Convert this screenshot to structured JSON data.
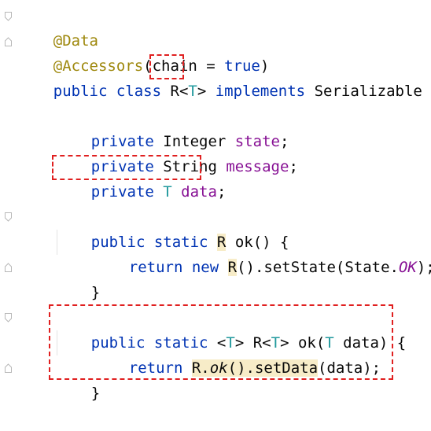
{
  "editor": {
    "lines": [
      {
        "id": "l1",
        "tokens": [
          "@Data"
        ]
      },
      {
        "id": "l2",
        "tokens": [
          "@Accessors",
          "(chain = ",
          "true",
          ")"
        ]
      },
      {
        "id": "l3",
        "tokens": [
          "public class ",
          "R",
          "<",
          "T",
          ">",
          " implements ",
          "Serializable {"
        ]
      },
      {
        "id": "l5",
        "tokens": [
          "private ",
          "Integer ",
          "state",
          ";"
        ]
      },
      {
        "id": "l6",
        "tokens": [
          "private ",
          "String ",
          "message",
          ";"
        ]
      },
      {
        "id": "l7",
        "tokens": [
          "private ",
          "T ",
          "data",
          ";"
        ]
      },
      {
        "id": "l9",
        "tokens": [
          "public static ",
          "R",
          " ok() {"
        ]
      },
      {
        "id": "l10",
        "tokens": [
          "return new ",
          "R",
          "().setState(State.",
          "OK",
          ");"
        ]
      },
      {
        "id": "l11",
        "tokens": [
          "}"
        ]
      },
      {
        "id": "l13",
        "tokens": [
          "public static ",
          "<",
          "T",
          "> ",
          "R",
          "<",
          "T",
          "> ok(",
          "T",
          " data) {"
        ]
      },
      {
        "id": "l14",
        "tokens": [
          "return ",
          "R.",
          "ok",
          "().setData",
          "(data);"
        ]
      },
      {
        "id": "l15",
        "tokens": [
          "}"
        ]
      }
    ]
  },
  "colors": {
    "keyword": "#0033b3",
    "annotation": "#9e880d",
    "field": "#871094",
    "type_param": "#20999d",
    "highlight_bg": "#f7ecc8",
    "annotation_box": "#e02020"
  }
}
